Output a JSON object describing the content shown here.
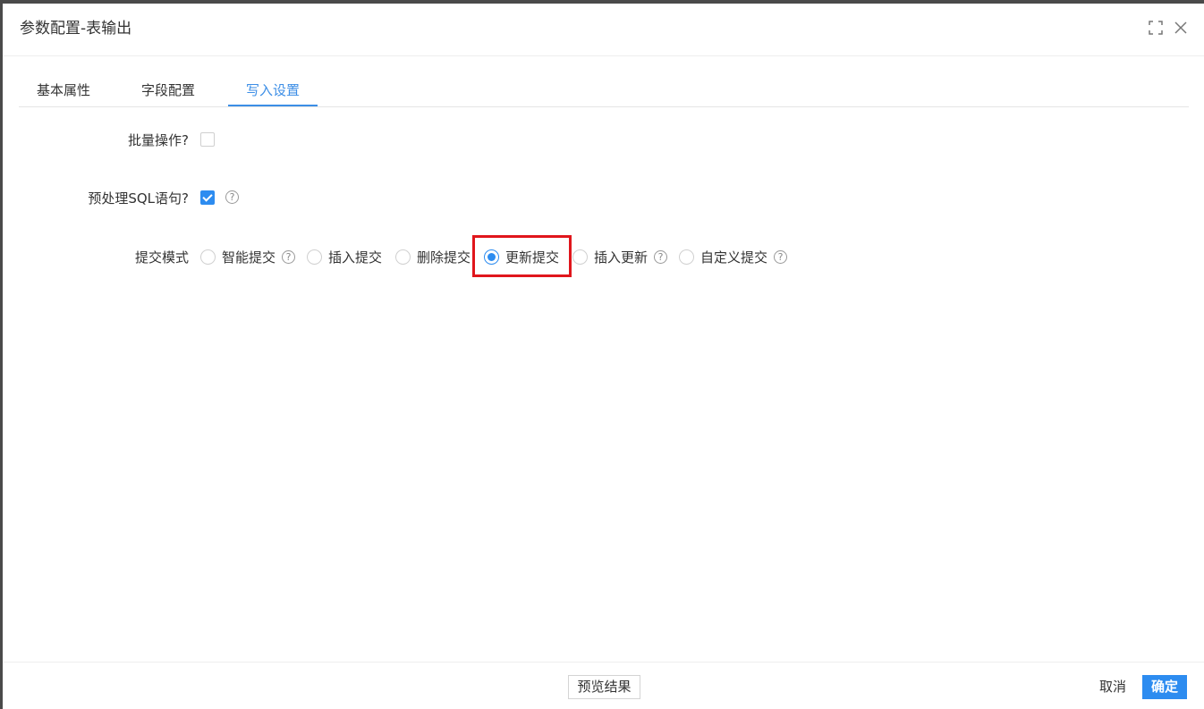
{
  "dialog": {
    "title": "参数配置-表输出"
  },
  "tabs": [
    {
      "label": "基本属性",
      "active": false
    },
    {
      "label": "字段配置",
      "active": false
    },
    {
      "label": "写入设置",
      "active": true
    }
  ],
  "form": {
    "batch": {
      "label": "批量操作?",
      "checked": false
    },
    "prepared": {
      "label": "预处理SQL语句?",
      "checked": true,
      "help_icon": "question-circle-icon"
    },
    "commit_mode": {
      "label": "提交模式",
      "options": [
        {
          "label": "智能提交",
          "checked": false,
          "has_help": true
        },
        {
          "label": "插入提交",
          "checked": false,
          "has_help": false
        },
        {
          "label": "删除提交",
          "checked": false,
          "has_help": false
        },
        {
          "label": "更新提交",
          "checked": true,
          "has_help": false
        },
        {
          "label": "插入更新",
          "checked": false,
          "has_help": true
        },
        {
          "label": "自定义提交",
          "checked": false,
          "has_help": true
        }
      ],
      "help_glyph": "?"
    }
  },
  "footer": {
    "preview_label": "预览结果",
    "cancel_label": "取消",
    "ok_label": "确定"
  },
  "colors": {
    "accent": "#2d8cf0",
    "tab_active": "#3c8ee6",
    "highlight": "#e0161c"
  }
}
